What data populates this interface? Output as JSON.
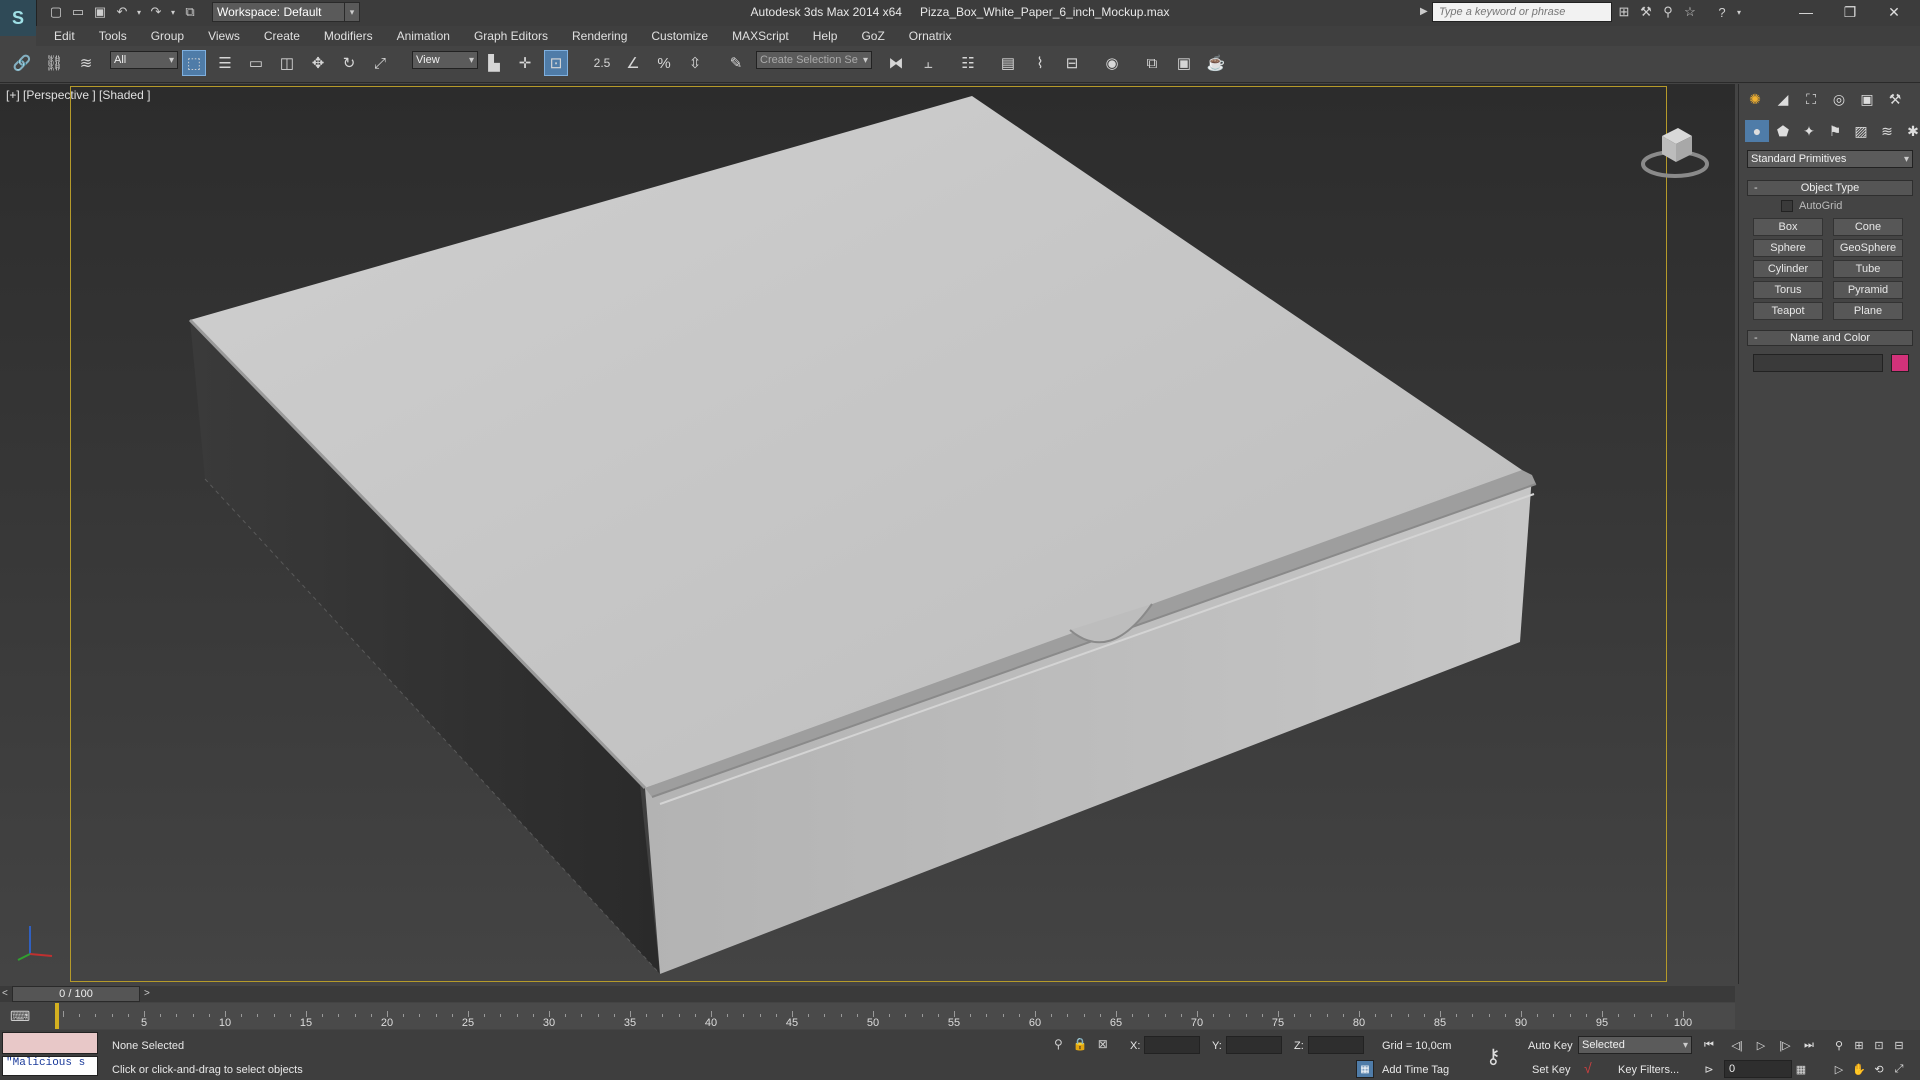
{
  "title": {
    "app": "Autodesk 3ds Max  2014 x64",
    "file": "Pizza_Box_White_Paper_6_inch_Mockup.max",
    "workspace": "Workspace: Default",
    "search_placeholder": "Type a keyword or phrase"
  },
  "menu": [
    "Edit",
    "Tools",
    "Group",
    "Views",
    "Create",
    "Modifiers",
    "Animation",
    "Graph Editors",
    "Rendering",
    "Customize",
    "MAXScript",
    "Help",
    "GoZ",
    "Ornatrix"
  ],
  "toolbar": {
    "selection_filter": "All",
    "reference_coord": "View",
    "snap_label": "2.5",
    "selection_set_placeholder": "Create Selection Se"
  },
  "viewport": {
    "label": "[+] [Perspective ] [Shaded ]"
  },
  "command_panel": {
    "category": "Standard Primitives",
    "object_type_title": "Object Type",
    "autogrid": "AutoGrid",
    "primitives": [
      "Box",
      "Cone",
      "Sphere",
      "GeoSphere",
      "Cylinder",
      "Tube",
      "Torus",
      "Pyramid",
      "Teapot",
      "Plane"
    ],
    "name_color_title": "Name and Color",
    "object_color": "#d2327a"
  },
  "timeline": {
    "frame_display": "0 / 100",
    "ticks": [
      "5",
      "10",
      "15",
      "20",
      "25",
      "30",
      "35",
      "40",
      "45",
      "50",
      "55",
      "60",
      "65",
      "70",
      "75",
      "80",
      "85",
      "90",
      "95",
      "100"
    ]
  },
  "status": {
    "script_listener": "\"Malicious s",
    "selection": "None Selected",
    "prompt": "Click or click-and-drag to select objects",
    "x_label": "X:",
    "y_label": "Y:",
    "z_label": "Z:",
    "grid": "Grid = 10,0cm",
    "add_time_tag": "Add Time Tag",
    "auto_key": "Auto Key",
    "set_key": "Set Key",
    "key_mode": "Selected",
    "key_filters": "Key Filters...",
    "current_frame": "0"
  },
  "colors": {
    "accent": "#4f7ca8",
    "safe_frame": "#b59a2a"
  }
}
